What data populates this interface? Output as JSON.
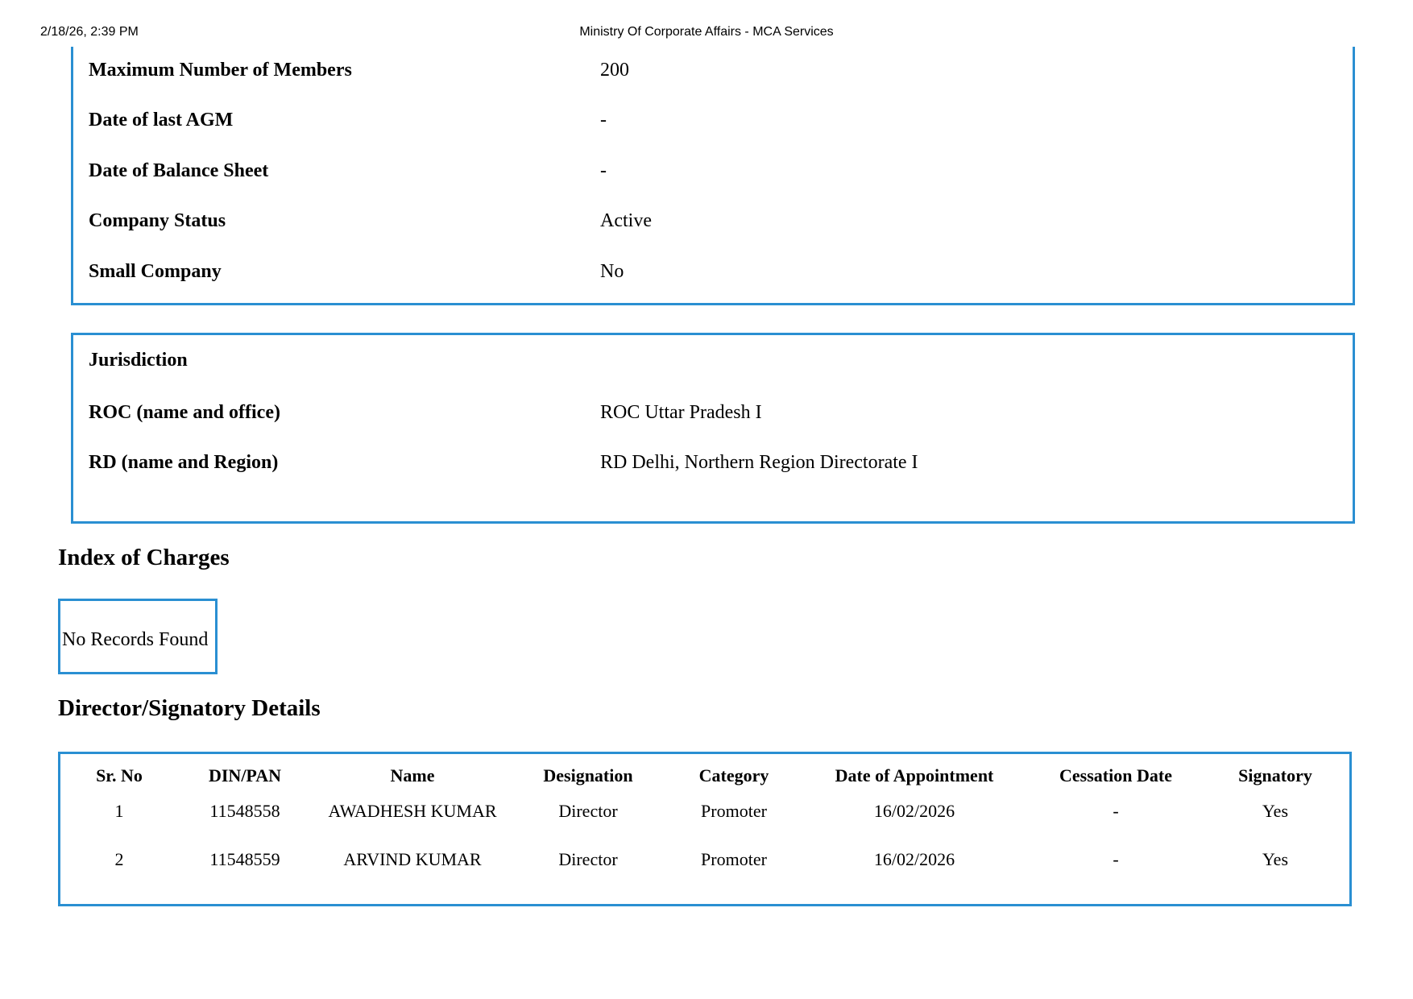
{
  "print_header": {
    "datetime": "2/18/26, 2:39 PM",
    "title": "Ministry Of Corporate Affairs - MCA Services"
  },
  "company_info": [
    {
      "label": "Maximum Number of Members",
      "value": "200"
    },
    {
      "label": "Date of last AGM",
      "value": "-"
    },
    {
      "label": "Date of Balance Sheet",
      "value": "-"
    },
    {
      "label": "Company Status",
      "value": "Active"
    },
    {
      "label": "Small Company",
      "value": "No"
    }
  ],
  "jurisdiction": {
    "heading": "Jurisdiction",
    "rows": [
      {
        "label": "ROC (name and office)",
        "value": "ROC Uttar Pradesh I"
      },
      {
        "label": "RD (name and Region)",
        "value": "RD Delhi, Northern Region Directorate I"
      }
    ]
  },
  "index_of_charges": {
    "title": "Index of Charges",
    "empty_text": "No Records Found"
  },
  "directors": {
    "title": "Director/Signatory Details",
    "columns": [
      "Sr. No",
      "DIN/PAN",
      "Name",
      "Designation",
      "Category",
      "Date of Appointment",
      "Cessation Date",
      "Signatory"
    ],
    "rows": [
      [
        "1",
        "11548558",
        "AWADHESH KUMAR",
        "Director",
        "Promoter",
        "16/02/2026",
        "-",
        "Yes"
      ],
      [
        "2",
        "11548559",
        "ARVIND KUMAR",
        "Director",
        "Promoter",
        "16/02/2026",
        "-",
        "Yes"
      ]
    ]
  },
  "colors": {
    "border": "#2a8fd2"
  }
}
